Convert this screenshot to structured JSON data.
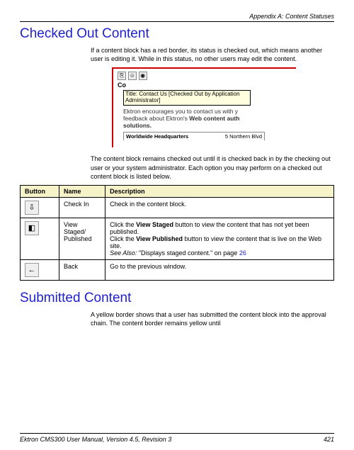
{
  "header": {
    "appendix": "Appendix A: Content Statuses"
  },
  "section1": {
    "title": "Checked Out Content",
    "p1": "If a content block has a red border, its status is checked out, which means another user is editing it. While in this status, no other users may edit the content.",
    "screenshot": {
      "cut_label": "Co",
      "tooltip": "Title: Contact Us [Checked Out by Application\nAdministrator]",
      "blurb_line1": "Ektron encourages you to contact us with y",
      "blurb_line2": "feedback about Ektron's ",
      "blurb_bold": "Web content auth",
      "blurb_line3": "solutions.",
      "sub_left": "Worldwide Headquarters",
      "sub_right": "5 Northern Blvd"
    },
    "p2": "The content block remains checked out until it is checked back in by the checking out user or your system administrator. Each option you may perform on a checked out content block is listed below.",
    "table": {
      "headers": [
        "Button",
        "Name",
        "Description"
      ],
      "rows": [
        {
          "icon": "⇩",
          "name": "Check In",
          "desc": "Check in the content block."
        },
        {
          "icon": "◧",
          "name": "View Staged/\nPublished",
          "desc_1": "Click the ",
          "desc_b1": "View Staged",
          "desc_2": " button to view the content that has not yet been published.",
          "desc_3": "Click the ",
          "desc_b2": "View Published",
          "desc_4": " button to view the content that is live on the Web site.",
          "see_also_prefix": "See Also: ",
          "see_also_text": "\"Displays staged content.\" on page ",
          "see_also_page": "26"
        },
        {
          "icon": "←",
          "name": "Back",
          "desc": "Go to the previous window."
        }
      ]
    }
  },
  "section2": {
    "title": "Submitted Content",
    "p1": "A yellow border shows that a user has submitted the content block into the approval chain. The content border remains yellow until"
  },
  "footer": {
    "left": "Ektron CMS300 User Manual, Version 4.5, Revision 3",
    "page": "421"
  }
}
